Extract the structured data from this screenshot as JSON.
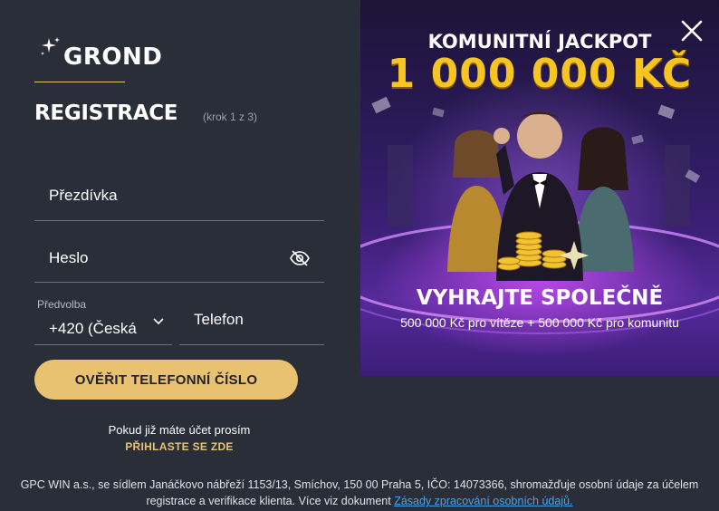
{
  "brand": {
    "name": "GROND"
  },
  "form": {
    "title": "REGISTRACE",
    "step": "(krok 1 z 3)",
    "nickname_placeholder": "Přezdívka",
    "password_placeholder": "Heslo",
    "prefix_label": "Předvolba",
    "prefix_value": "+420 (Česká",
    "phone_placeholder": "Telefon",
    "verify_button": "OVĚŘIT TELEFONNÍ ČÍSLO",
    "login_prompt": "Pokud již máte účet prosím",
    "login_link": "PŘIHLASTE SE ZDE"
  },
  "footer": {
    "text": "GPC WIN a.s., se sídlem Janáčkovo nábřeží 1153/13, Smíchov, 150 00 Praha 5, IČO: 14073366, shromažďuje osobní údaje za účelem registrace a verifikace klienta. Více viz dokument",
    "link": "Zásady zpracování osobních údajů."
  },
  "promo": {
    "heading": "KOMUNITNÍ JACKPOT",
    "amount": "1 000 000 KČ",
    "win_title": "VYHRAJTE SPOLEČNĚ",
    "subtitle": "500 000 Kč pro vítěze + 500 000 Kč pro komunitu"
  },
  "icons": {
    "logo": "sparkle-icon",
    "password_visibility": "eye-slash-icon",
    "dropdown": "chevron-down-icon",
    "close": "close-icon"
  },
  "colors": {
    "background": "#2a2e39",
    "accent": "#e8c271",
    "link": "#4aa3e6",
    "jackpot": "#f7c522"
  }
}
